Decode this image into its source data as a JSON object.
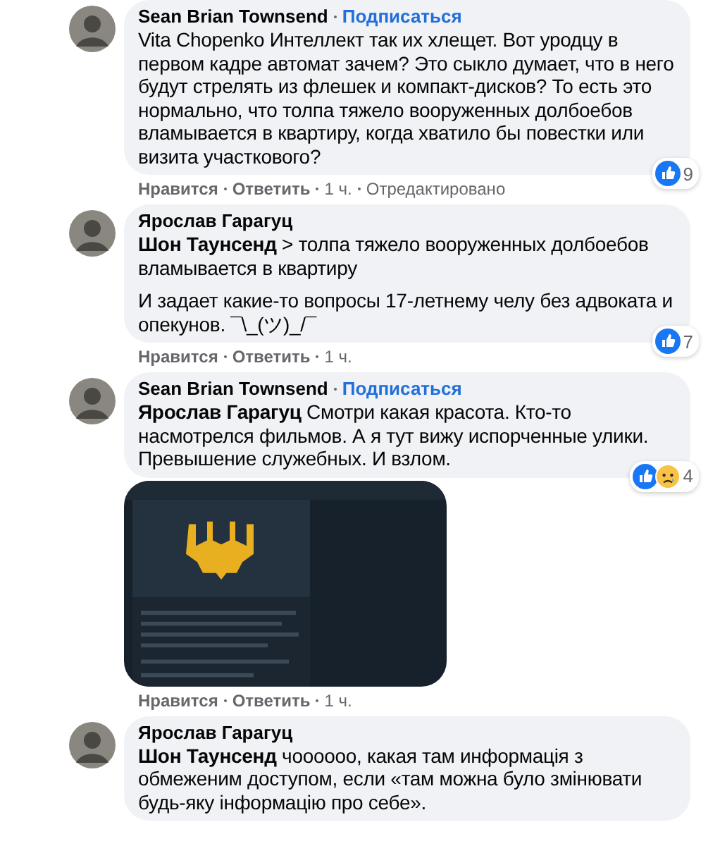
{
  "comments": [
    {
      "author": "Sean Brian Townsend",
      "follow": "Подписаться",
      "paragraphs": [
        "Vita Chopenko Интеллект так их хлещет. Вот уродцу в первом кадре автомат зачем? Это сыкло думает, что в него будут стрелять из флешек и компакт-дисков? То есть это нормально, что толпа тяжело вооруженных долбоебов вламывается в квартиру, когда хватило бы повестки или визита участкового?"
      ],
      "reactions": {
        "like": true,
        "sad": false,
        "count": "9"
      },
      "actions": {
        "like": "Нравится",
        "reply": "Ответить",
        "time": "1 ч.",
        "edited": "Отредактировано"
      }
    },
    {
      "author": "Ярослав Гарагуц",
      "paragraphs": [
        "**Шон Таунсенд** > толпа тяжело вооруженных долбоебов вламывается в квартиру",
        "И задает какие-то вопросы 17-летнему челу без адвоката и опекунов. ¯\\_(ツ)_/¯"
      ],
      "reactions": {
        "like": true,
        "sad": false,
        "count": "7"
      },
      "actions": {
        "like": "Нравится",
        "reply": "Ответить",
        "time": "1 ч."
      }
    },
    {
      "author": "Sean Brian Townsend",
      "follow": "Подписаться",
      "paragraphs": [
        "**Ярослав Гарагуц** Смотри какая красота. Кто-то насмотрелся фильмов. А я тут вижу испорченные улики. Превышение служебных. И взлом."
      ],
      "attachment": {
        "kind": "picture"
      },
      "reactions": {
        "like": true,
        "sad": true,
        "count": "4"
      },
      "actions": {
        "like": "Нравится",
        "reply": "Ответить",
        "time": "1 ч."
      }
    },
    {
      "author": "Ярослав Гарагуц",
      "paragraphs": [
        "**Шон Таунсенд** чоооооо, какая там информація з обмеженим доступом, если «там можна було змінювати будь-яку інформацію про себе»."
      ]
    }
  ]
}
